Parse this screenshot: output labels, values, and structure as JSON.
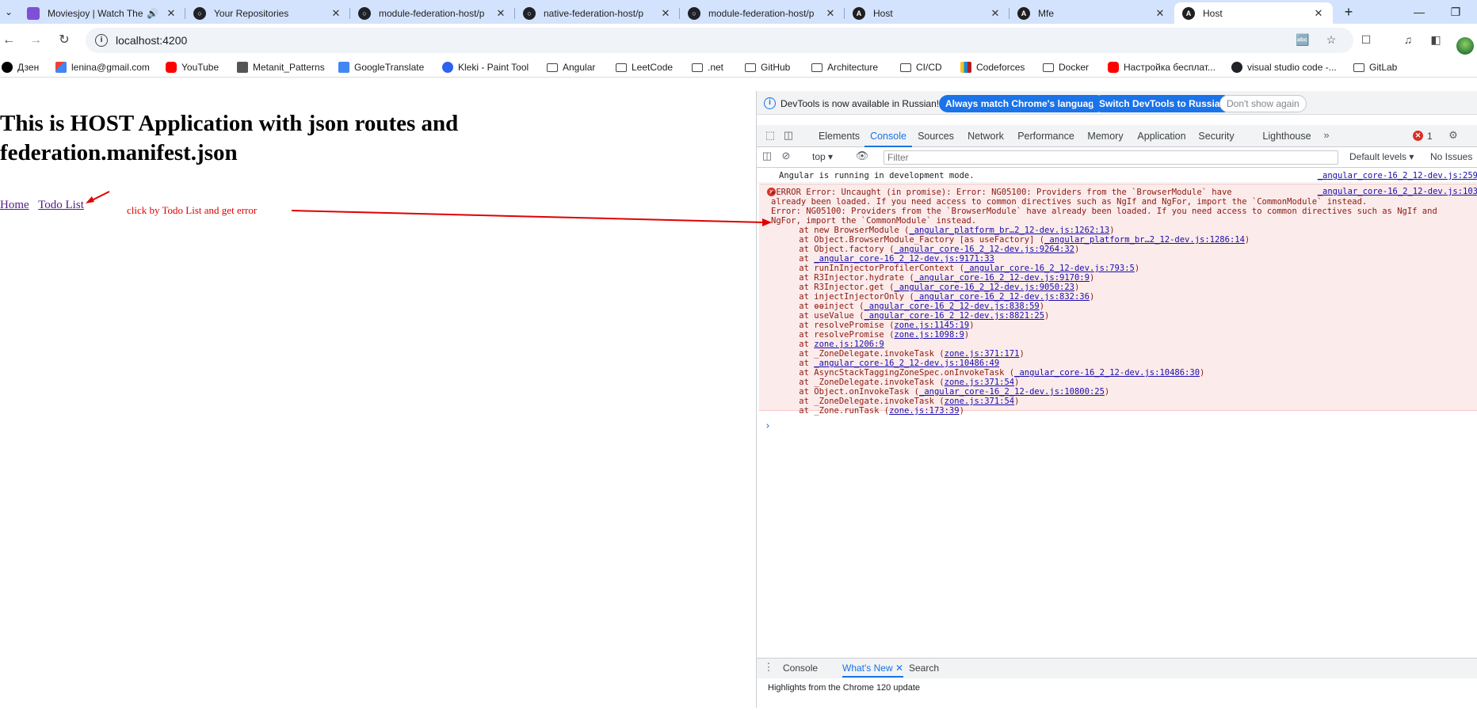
{
  "tabs": [
    {
      "title": "Moviesjoy | Watch The",
      "icon": "moviesjoy-icon",
      "sound": true
    },
    {
      "title": "Your Repositories",
      "icon": "github-icon"
    },
    {
      "title": "module-federation-host/p",
      "icon": "github-icon"
    },
    {
      "title": "native-federation-host/p",
      "icon": "github-icon"
    },
    {
      "title": "module-federation-host/p",
      "icon": "github-icon"
    },
    {
      "title": "Host",
      "icon": "angular-icon"
    },
    {
      "title": "Mfe",
      "icon": "angular-icon"
    },
    {
      "title": "Host",
      "icon": "angular-icon",
      "active": true
    }
  ],
  "address": {
    "url": "localhost:4200"
  },
  "bookmarks": [
    {
      "label": "Дзен",
      "icon": "dzen-icon"
    },
    {
      "label": "lenina@gmail.com",
      "icon": "gmail-icon"
    },
    {
      "label": "YouTube",
      "icon": "youtube-icon"
    },
    {
      "label": "Metanit_Patterns",
      "icon": "metanit-icon"
    },
    {
      "label": "GoogleTranslate",
      "icon": "google-translate-icon"
    },
    {
      "label": "Kleki - Paint Tool",
      "icon": "kleki-icon"
    },
    {
      "label": "Angular",
      "icon": "folder-icon"
    },
    {
      "label": "LeetCode",
      "icon": "folder-icon"
    },
    {
      "label": ".net",
      "icon": "folder-icon"
    },
    {
      "label": "GitHub",
      "icon": "folder-icon"
    },
    {
      "label": "Architecture",
      "icon": "folder-icon"
    },
    {
      "label": "CI/CD",
      "icon": "folder-icon"
    },
    {
      "label": "Codeforces",
      "icon": "codeforces-icon"
    },
    {
      "label": "Docker",
      "icon": "folder-icon"
    },
    {
      "label": "Настройка бесплат...",
      "icon": "youtube-icon"
    },
    {
      "label": "visual studio code -...",
      "icon": "github-icon"
    },
    {
      "label": "GitLab",
      "icon": "folder-icon"
    }
  ],
  "page": {
    "heading": "This is HOST Application with json routes and federation.manifest.json",
    "nav_home": "Home",
    "nav_todo": "Todo List",
    "annotation": "click by Todo List and get error",
    "annotation_color": "#e00000"
  },
  "devtools": {
    "notice": "DevTools is now available in Russian!",
    "btn_match": "Always match Chrome's language",
    "btn_switch": "Switch DevTools to Russian",
    "btn_dismiss": "Don't show again",
    "tabs": [
      "Elements",
      "Console",
      "Sources",
      "Network",
      "Performance",
      "Memory",
      "Application",
      "Security",
      "Lighthouse"
    ],
    "active_tab": "Console",
    "error_count": "1",
    "context": "top",
    "filter_placeholder": "Filter",
    "levels": "Default levels",
    "issues": "No Issues",
    "log_message": "Angular is running in development mode.",
    "log_source": "_angular_core-16_2_12-dev.js:259",
    "error_source": "_angular_core-16_2_12-dev.js:103",
    "error_lines": [
      {
        "text": "▸ERROR Error: Uncaught (in promise): Error: NG05100: Providers from the `BrowserModule` have",
        "link": ""
      },
      {
        "text": "already been loaded. If you need access to common directives such as NgIf and NgFor, import the `CommonModule` instead.",
        "link": ""
      },
      {
        "text": "Error: NG05100: Providers from the `BrowserModule` have already been loaded. If you need access to common directives such as NgIf and",
        "link": ""
      },
      {
        "text": "NgFor, import the `CommonModule` instead.",
        "link": ""
      },
      {
        "text": "    at new BrowserModule (",
        "link": "_angular_platform_br…2_12-dev.js:1262:13",
        "tail": ")"
      },
      {
        "text": "    at Object.BrowserModule_Factory [as useFactory] (",
        "link": "_angular_platform_br…2_12-dev.js:1286:14",
        "tail": ")"
      },
      {
        "text": "    at Object.factory (",
        "link": "_angular_core-16_2_12-dev.js:9264:32",
        "tail": ")"
      },
      {
        "text": "    at ",
        "link": "_angular_core-16_2_12-dev.js:9171:33",
        "tail": ""
      },
      {
        "text": "    at runInInjectorProfilerContext (",
        "link": "_angular_core-16_2_12-dev.js:793:5",
        "tail": ")"
      },
      {
        "text": "    at R3Injector.hydrate (",
        "link": "_angular_core-16_2_12-dev.js:9170:9",
        "tail": ")"
      },
      {
        "text": "    at R3Injector.get (",
        "link": "_angular_core-16_2_12-dev.js:9050:23",
        "tail": ")"
      },
      {
        "text": "    at injectInjectorOnly (",
        "link": "_angular_core-16_2_12-dev.js:832:36",
        "tail": ")"
      },
      {
        "text": "    at ɵɵinject (",
        "link": "_angular_core-16_2_12-dev.js:838:59",
        "tail": ")"
      },
      {
        "text": "    at useValue (",
        "link": "_angular_core-16_2_12-dev.js:8821:25",
        "tail": ")"
      },
      {
        "text": "    at resolvePromise (",
        "link": "zone.js:1145:19",
        "tail": ")"
      },
      {
        "text": "    at resolvePromise (",
        "link": "zone.js:1098:9",
        "tail": ")"
      },
      {
        "text": "    at ",
        "link": "zone.js:1206:9",
        "tail": ""
      },
      {
        "text": "    at _ZoneDelegate.invokeTask (",
        "link": "zone.js:371:171",
        "tail": ")"
      },
      {
        "text": "    at ",
        "link": "_angular_core-16_2_12-dev.js:10486:49",
        "tail": ""
      },
      {
        "text": "    at AsyncStackTaggingZoneSpec.onInvokeTask (",
        "link": "_angular_core-16_2_12-dev.js:10486:30",
        "tail": ")"
      },
      {
        "text": "    at _ZoneDelegate.invokeTask (",
        "link": "zone.js:371:54",
        "tail": ")"
      },
      {
        "text": "    at Object.onInvokeTask (",
        "link": "_angular_core-16_2_12-dev.js:10800:25",
        "tail": ")"
      },
      {
        "text": "    at _ZoneDelegate.invokeTask (",
        "link": "zone.js:371:54",
        "tail": ")"
      },
      {
        "text": "    at _Zone.runTask (",
        "link": "zone.js:173:39",
        "tail": ")"
      }
    ],
    "drawer_tabs": [
      "Console",
      "What's New",
      "Search"
    ],
    "drawer_active": "What's New",
    "drawer_text": "Highlights from the Chrome 120 update"
  }
}
